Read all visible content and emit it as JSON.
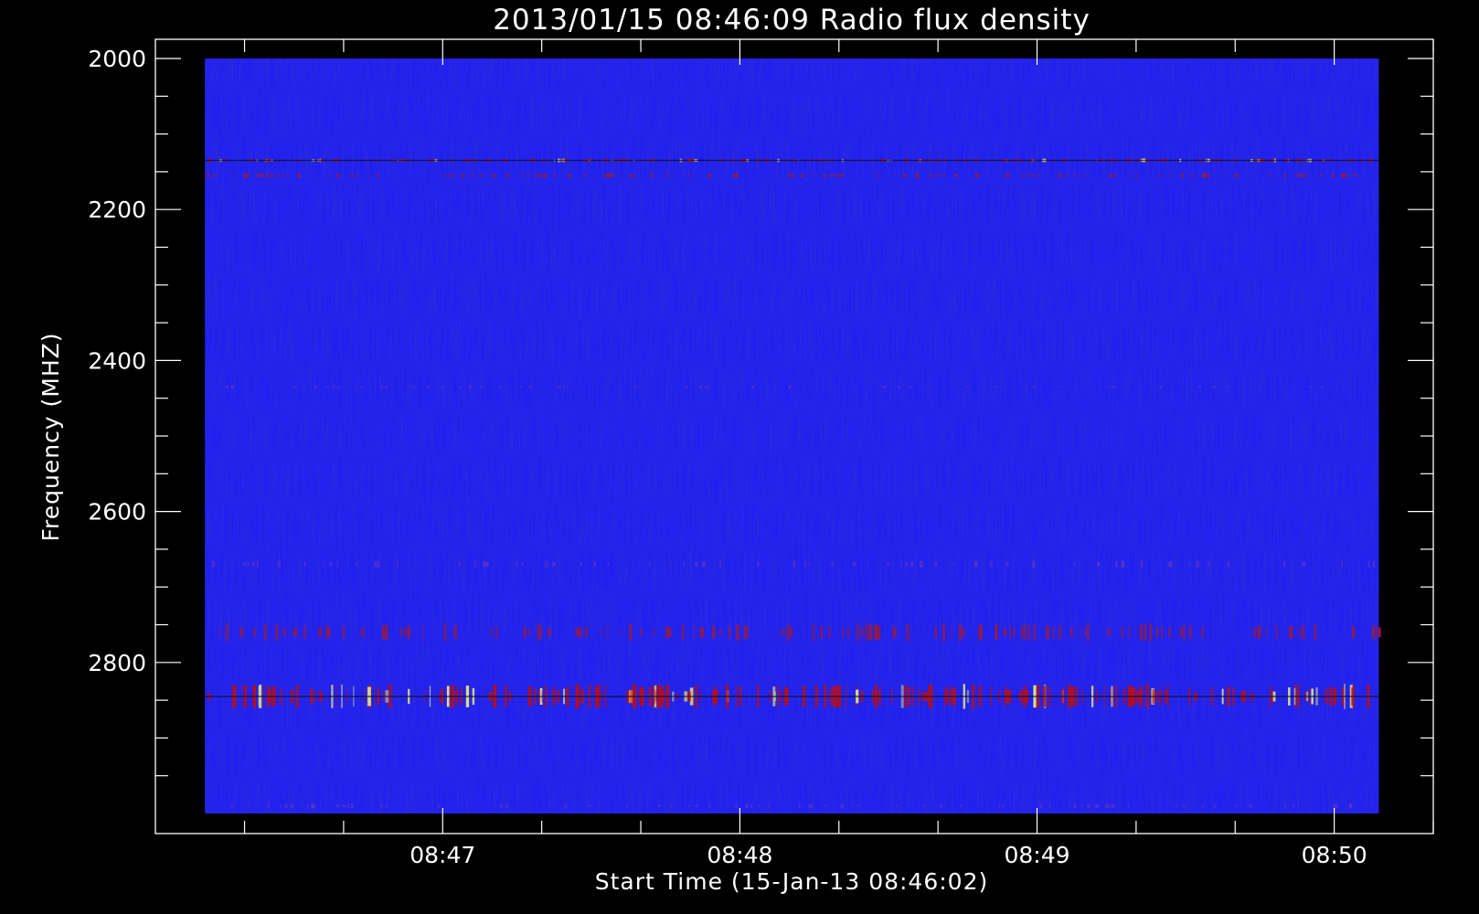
{
  "chart_data": {
    "type": "heatmap",
    "title": "2013/01/15 08:46:09 Radio flux density",
    "xlabel": "Start Time (15-Jan-13 08:46:02)",
    "ylabel": "Frequency (MHZ)",
    "x_start": "08:46:12",
    "x_end": "08:50:09",
    "xlim": [
      "08:46:02",
      "08:50:20"
    ],
    "xticks": [
      "08:47",
      "08:48",
      "08:49",
      "08:50"
    ],
    "ylim": [
      2000,
      3000
    ],
    "y_inverted": true,
    "yticks": [
      2000,
      2200,
      2400,
      2600,
      2800
    ],
    "background_color": "#1a1aff",
    "colors": {
      "background": "#000000",
      "axis": "#ffffff",
      "low": "#0000cc",
      "mid": "#2020ff",
      "high": "#cc0000",
      "peak": "#ffff80"
    },
    "emission_bands_mhz": [
      {
        "frequency": 2135,
        "width": 4,
        "intensity": "high"
      },
      {
        "frequency": 2155,
        "width": 5,
        "intensity": "medium"
      },
      {
        "frequency": 2435,
        "width": 3,
        "intensity": "low"
      },
      {
        "frequency": 2670,
        "width": 8,
        "intensity": "low"
      },
      {
        "frequency": 2760,
        "width": 20,
        "intensity": "medium"
      },
      {
        "frequency": 2845,
        "width": 28,
        "intensity": "high"
      },
      {
        "frequency": 2990,
        "width": 6,
        "intensity": "low"
      }
    ]
  }
}
